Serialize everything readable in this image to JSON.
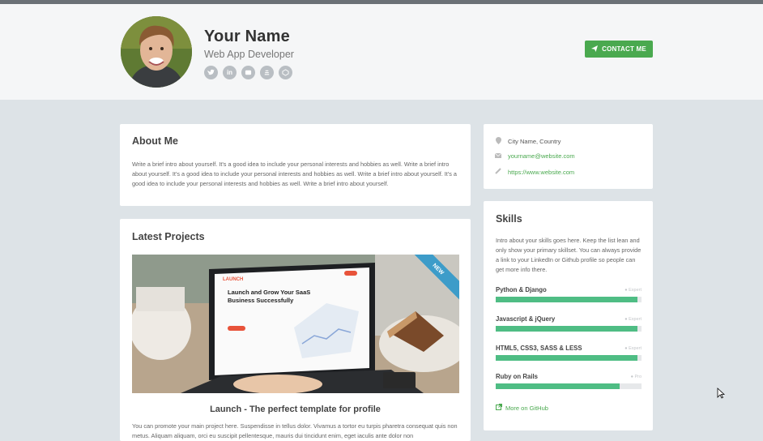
{
  "header": {
    "name": "Your Name",
    "role": "Web App Developer",
    "contact_label": "CONTACT ME",
    "social_icons": [
      "twitter-icon",
      "linkedin-icon",
      "github-icon",
      "stackoverflow-icon",
      "codepen-icon"
    ]
  },
  "about": {
    "title": "About Me",
    "text": "Write a brief intro about yourself. It's a good idea to include your personal interests and hobbies as well. Write a brief intro about yourself. It's a good idea to include your personal interests and hobbies as well. Write a brief intro about yourself. It's a good idea to include your personal interests and hobbies as well. Write a brief intro about yourself."
  },
  "projects": {
    "title": "Latest Projects",
    "badge": "NEW",
    "screen": {
      "brand": "LAUNCH",
      "headline": "Launch and Grow Your SaaS Business Successfully"
    },
    "project_title": "Launch - The perfect template for profile",
    "project_desc": "You can promote your main project here. Suspendisse in tellus dolor. Vivamus a tortor eu turpis pharetra consequat quis non metus. Aliquam aliquam, orci eu suscipit pellentesque, mauris dui tincidunt enim, eget iaculis ante dolor non"
  },
  "info": {
    "location": "City Name, Country",
    "email": "yourname@website.com",
    "website": "https://www.website.com"
  },
  "skills": {
    "title": "Skills",
    "intro": "Intro about your skills goes here. Keep the list lean and only show your primary skillset. You can always provide a link to your LinkedIn or Github profile so people can get more info there.",
    "items": [
      {
        "name": "Python & Django",
        "level": "Expert",
        "value": 0.97
      },
      {
        "name": "Javascript & jQuery",
        "level": "Expert",
        "value": 0.97
      },
      {
        "name": "HTML5, CSS3, SASS & LESS",
        "level": "Expert",
        "value": 0.97
      },
      {
        "name": "Ruby on Rails",
        "level": "Pro",
        "value": 0.85
      }
    ],
    "github_link": "More on GitHub"
  },
  "colors": {
    "accent": "#4aa94f",
    "skill_bar": "#4fbd84",
    "badge": "#3d9cc9"
  }
}
